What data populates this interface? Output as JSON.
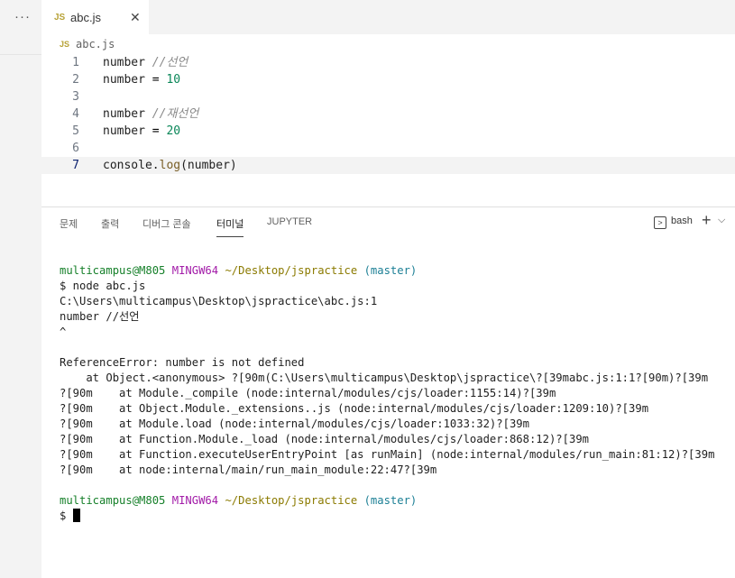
{
  "explorer": {
    "more_label": "···"
  },
  "tab": {
    "badge": "JS",
    "label": "abc.js",
    "close": "✕"
  },
  "breadcrumb": {
    "badge": "JS",
    "label": "abc.js"
  },
  "editor": {
    "lines": [
      {
        "num": "1",
        "tokens": [
          {
            "t": "number ",
            "c": "ident"
          },
          {
            "t": "//선언",
            "c": "comment"
          }
        ]
      },
      {
        "num": "2",
        "tokens": [
          {
            "t": "number ",
            "c": "ident"
          },
          {
            "t": "=",
            "c": "op"
          },
          {
            "t": " ",
            "c": "ident"
          },
          {
            "t": "10",
            "c": "num"
          }
        ]
      },
      {
        "num": "3",
        "tokens": []
      },
      {
        "num": "4",
        "tokens": [
          {
            "t": "number ",
            "c": "ident"
          },
          {
            "t": "//재선언",
            "c": "comment"
          }
        ]
      },
      {
        "num": "5",
        "tokens": [
          {
            "t": "number ",
            "c": "ident"
          },
          {
            "t": "=",
            "c": "op"
          },
          {
            "t": " ",
            "c": "ident"
          },
          {
            "t": "20",
            "c": "num"
          }
        ]
      },
      {
        "num": "6",
        "tokens": []
      },
      {
        "num": "7",
        "tokens": [
          {
            "t": "console.",
            "c": "ident"
          },
          {
            "t": "log",
            "c": "func"
          },
          {
            "t": "(number)",
            "c": "ident"
          }
        ],
        "active": true
      }
    ]
  },
  "panel": {
    "tabs": [
      "문제",
      "출력",
      "디버그 콘솔",
      "터미널",
      "JUPYTER"
    ],
    "active_tab": "터미널",
    "shell_label": "bash",
    "plus": "+",
    "chevron": "⌵"
  },
  "terminal": {
    "prompt1": {
      "user": "multicampus@M805",
      "env": "MINGW64",
      "path": "~/Desktop/jspractice",
      "branch": "(master)"
    },
    "lines": [
      "$ node abc.js",
      "C:\\Users\\multicampus\\Desktop\\jspractice\\abc.js:1",
      "number //선언",
      "^",
      "",
      "ReferenceError: number is not defined",
      "    at Object.<anonymous> ?[90m(C:\\Users\\multicampus\\Desktop\\jspractice\\?[39mabc.js:1:1?[90m)?[39m",
      "?[90m    at Module._compile (node:internal/modules/cjs/loader:1155:14)?[39m",
      "?[90m    at Object.Module._extensions..js (node:internal/modules/cjs/loader:1209:10)?[39m",
      "?[90m    at Module.load (node:internal/modules/cjs/loader:1033:32)?[39m",
      "?[90m    at Function.Module._load (node:internal/modules/cjs/loader:868:12)?[39m",
      "?[90m    at Function.executeUserEntryPoint [as runMain] (node:internal/modules/run_main:81:12)?[39m",
      "?[90m    at node:internal/main/run_main_module:22:47?[39m",
      ""
    ],
    "prompt2": {
      "user": "multicampus@M805",
      "env": "MINGW64",
      "path": "~/Desktop/jspractice",
      "branch": "(master)"
    },
    "final_prompt": "$ "
  }
}
